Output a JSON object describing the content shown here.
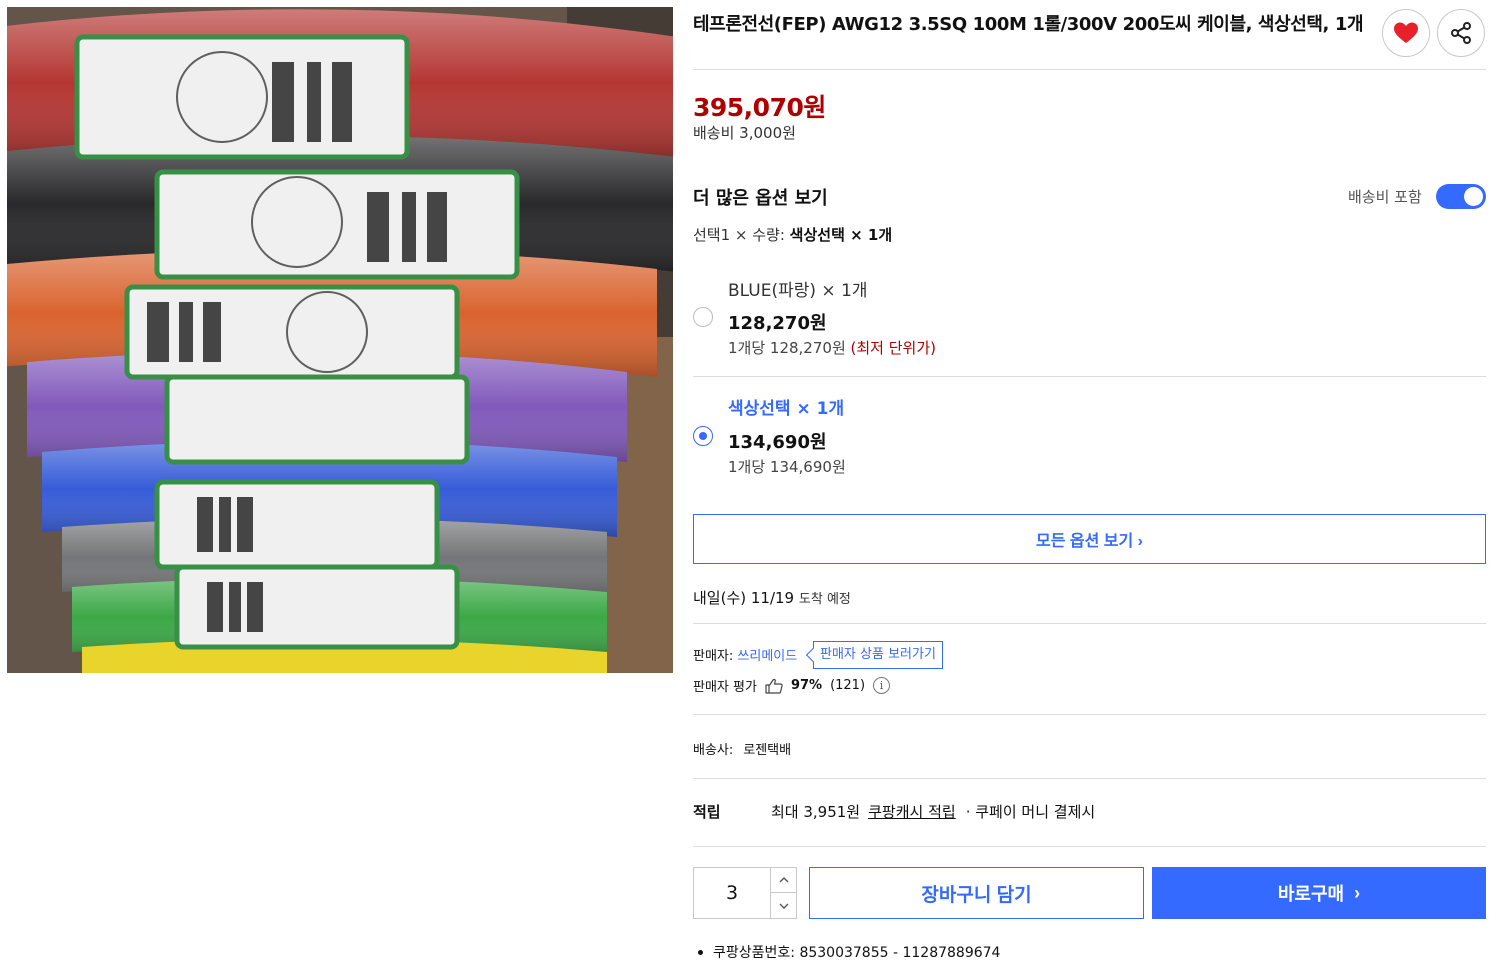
{
  "product": {
    "title": "테프론전선(FEP) AWG12 3.5SQ 100M 1롤/300V 200도씨 케이블, 색상선택, 1개",
    "price": "395,070원",
    "shipping_fee": "배송비 3,000원",
    "photo_icon": "cable-rolls-photo"
  },
  "options": {
    "heading": "더 많은 옵션 보기",
    "shipping_included_label": "배송비 포함",
    "shipping_included_on": true,
    "selected_prefix": "선택1 × 수량: ",
    "selected_value": "색상선택 × 1개",
    "items": [
      {
        "name": "BLUE(파랑) × 1개",
        "price": "128,270원",
        "unit": "1개당 128,270원",
        "badge": "(최저 단위가)",
        "selected": false
      },
      {
        "name": "색상선택 × 1개",
        "price": "134,690원",
        "unit": "1개당 134,690원",
        "badge": "",
        "selected": true
      }
    ],
    "all_options_label": "모든 옵션 보기 ›"
  },
  "delivery": {
    "date": "내일(수) 11/19",
    "suffix": "도착 예정"
  },
  "seller": {
    "label": "판매자: ",
    "name": "쓰리메이드",
    "view_products": "판매자 상품 보러가기",
    "rating_label": "판매자 평가",
    "rating_pct": "97%",
    "rating_count": "(121)",
    "info_glyph": "i"
  },
  "courier": {
    "label": "배송사:",
    "name": "로젠택배"
  },
  "reward": {
    "label": "적립",
    "max": "최대 3,951원",
    "cash": "쿠팡캐시 적립",
    "pay": "· 쿠페이 머니 결제시"
  },
  "purchase": {
    "quantity": "3",
    "cart_label": "장바구니 담기",
    "buy_label": "바로구매",
    "buy_arrow": "›"
  },
  "meta": {
    "product_no": "쿠팡상품번호: 8530037855 - 11287889674"
  },
  "colors": {
    "accent": "#346aff",
    "price_red": "#ae0000",
    "heart_red": "#e8202a"
  },
  "icons": [
    "heart-icon",
    "share-icon",
    "thumbs-up-icon",
    "info-icon",
    "chevron-up-icon",
    "chevron-down-icon",
    "chevron-right-icon"
  ]
}
